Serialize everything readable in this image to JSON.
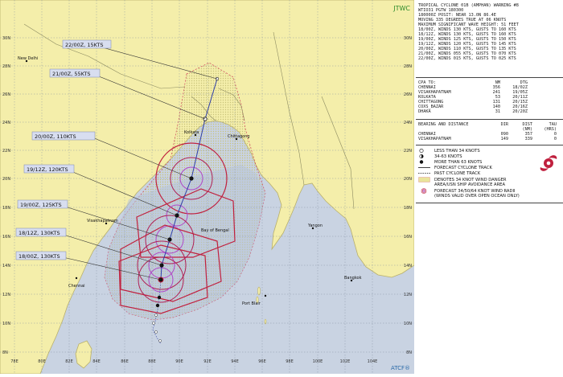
{
  "header": {
    "agency": "JTWC",
    "footer_mark": "ATCF®"
  },
  "map": {
    "lat_labels": [
      "30N",
      "28N",
      "26N",
      "24N",
      "22N",
      "20N",
      "18N",
      "16N",
      "14N",
      "12N",
      "10N",
      "8N"
    ],
    "lon_labels": [
      "78E",
      "80E",
      "82E",
      "84E",
      "86E",
      "88E",
      "90E",
      "92E",
      "94E",
      "96E",
      "98E",
      "100E",
      "102E",
      "104E"
    ],
    "places": [
      "New Delhi",
      "Kolkata",
      "Chittagong",
      "Visakhapatnam",
      "Bay of Bengal",
      "Yangon",
      "Bangkok",
      "Chennai",
      "Port Blair"
    ],
    "forecasts": [
      "22/00Z, 15KTS",
      "21/00Z, 55KTS",
      "20/00Z, 110KTS",
      "19/12Z, 120KTS",
      "19/00Z, 125KTS",
      "18/12Z, 130KTS",
      "18/00Z, 130KTS"
    ],
    "colors": {
      "land": "#f4eeaa",
      "water": "#c9d3e2",
      "danger_area": "#e9e49a",
      "outline": "#b9b06a",
      "track": "#2e3da8",
      "radius_34": "#c0203e",
      "radius_64": "#b047c8",
      "label_box": "#d8def0"
    }
  },
  "panel": {
    "warning_lines": [
      "TROPICAL CYCLONE 01B (AMPHAN) WARNING #8",
      "WTIO31 PGTW 180300",
      "180000Z POSIT: NEAR 13.0N 86.4E",
      "MOVING 335 DEGREES TRUE AT 06 KNOTS",
      "MAXIMUM SIGNIFICANT WAVE HEIGHT: 51 FEET",
      "18/00Z, WINDS 130 KTS, GUSTS TO 160 KTS",
      "18/12Z, WINDS 130 KTS, GUSTS TO 160 KTS",
      "19/00Z, WINDS 125 KTS, GUSTS TO 150 KTS",
      "19/12Z, WINDS 120 KTS, GUSTS TO 145 KTS",
      "20/00Z, WINDS 110 KTS, GUSTS TO 135 KTS",
      "21/00Z, WINDS 055 KTS, GUSTS TO 070 KTS",
      "22/00Z, WINDS 015 KTS, GUSTS TO 025 KTS"
    ],
    "cpa_header": [
      "CPA TO:",
      "NM",
      "DTG",
      ""
    ],
    "cpa_rows": [
      [
        "CHENNAI",
        "356",
        "18/02Z",
        ""
      ],
      [
        "VISAKHAPATNAM",
        "241",
        "19/05Z",
        ""
      ],
      [
        "KOLKATA",
        "53",
        "20/11Z",
        ""
      ],
      [
        "CHITTAGONG",
        "131",
        "20/15Z",
        ""
      ],
      [
        "COXS_BAZAR",
        "140",
        "20/16Z",
        ""
      ],
      [
        "DHAKA",
        "31",
        "20/20Z",
        ""
      ]
    ],
    "bearing_header": [
      "BEARING AND DISTANCE",
      "DIR",
      "DIST",
      "TAU"
    ],
    "bearing_units": [
      "",
      "",
      "(NM)",
      "(HRS)"
    ],
    "bearing_rows": [
      [
        "CHENNAI",
        "090",
        "357",
        "0"
      ],
      [
        "VISAKHAPATNAM",
        "149",
        "339",
        "0"
      ]
    ],
    "legend": [
      "LESS THAN 34 KNOTS",
      "34-63 KNOTS",
      "MORE THAN 63 KNOTS",
      "FORECAST CYCLONE TRACK",
      "PAST CYCLONE TRACK",
      "DENOTES 34 KNOT WIND DANGER",
      "AREA/USN SHIP AVOIDANCE AREA",
      "FORECAST 34/50/64 KNOT WIND RADII",
      "(WINDS VALID OVER OPEN OCEAN ONLY)"
    ]
  }
}
